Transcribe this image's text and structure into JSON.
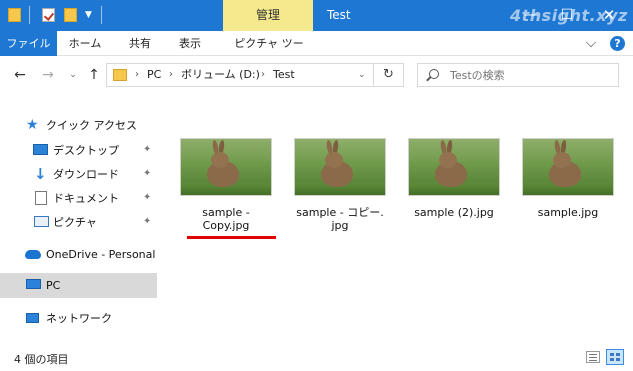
{
  "titlebar": {
    "manage_tab": "管理",
    "title": "Test",
    "minimize": "—",
    "maximize": "☐",
    "close": "✕",
    "watermark": "4thsight.xyz"
  },
  "ribbon": {
    "tabs": {
      "file": "ファイル",
      "home": "ホーム",
      "share": "共有",
      "view": "表示",
      "picture_tools": "ピクチャ ツール"
    },
    "help": "?"
  },
  "navigation": {
    "back": "←",
    "forward": "→",
    "recent": "⌄",
    "up": "↑",
    "breadcrumb": [
      "PC",
      "ボリューム (D:)",
      "Test"
    ],
    "breadcrumb_sep": "›",
    "refresh": "↻"
  },
  "search": {
    "placeholder": "Testの検索"
  },
  "sidebar": {
    "quick_access": "クイック アクセス",
    "desktop": "デスクトップ",
    "downloads": "ダウンロード",
    "documents": "ドキュメント",
    "pictures": "ピクチャ",
    "onedrive": "OneDrive - Personal",
    "pc": "PC",
    "network": "ネットワーク",
    "pin": "📌"
  },
  "files": [
    {
      "name": "sample - Copy.jpg"
    },
    {
      "name": "sample - コピー.jpg"
    },
    {
      "name": "sample (2).jpg"
    },
    {
      "name": "sample.jpg"
    }
  ],
  "file_lines": {
    "f0": [
      "sample -",
      "Copy.jpg"
    ],
    "f1": [
      "sample - コピー.",
      "jpg"
    ],
    "f2": [
      "sample (2).jpg"
    ],
    "f3": [
      "sample.jpg"
    ]
  },
  "status": {
    "item_count": "4 個の項目"
  },
  "colors": {
    "accent": "#1e77d3",
    "manage_tab": "#f5e98e",
    "highlight": "#e00000"
  }
}
